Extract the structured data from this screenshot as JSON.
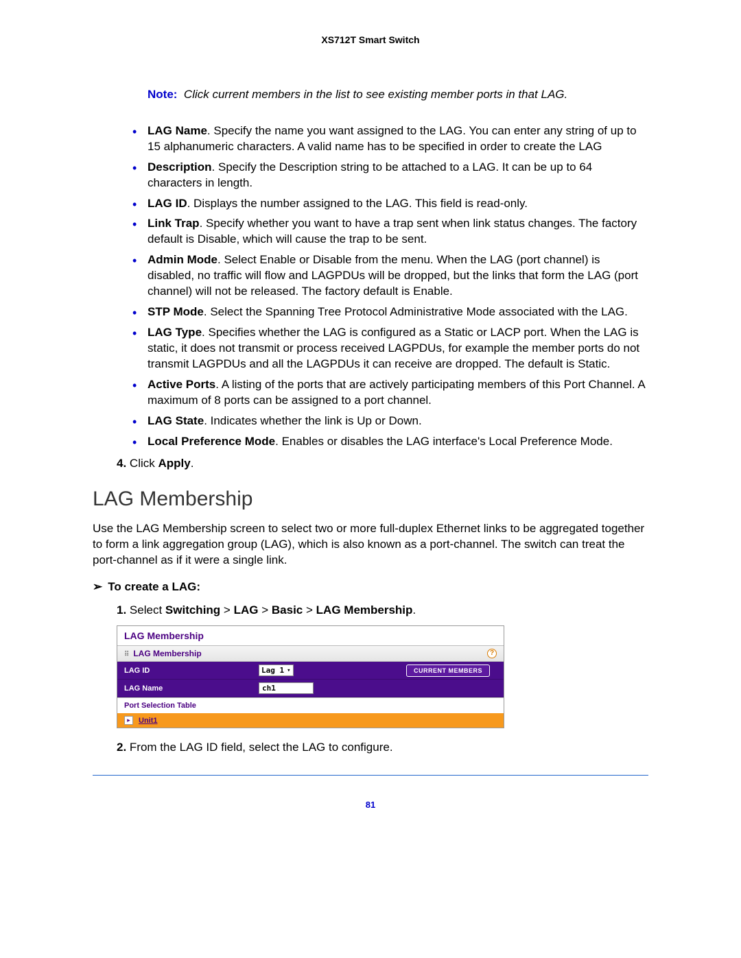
{
  "header": "XS712T Smart Switch",
  "note": {
    "label": "Note:",
    "text": "Click current members in the list to see existing member ports in that LAG."
  },
  "bullets": [
    {
      "term": "LAG Name",
      "desc": ". Specify the name you want assigned to the LAG. You can enter any string of up to 15 alphanumeric characters. A valid name has to be specified in order to create the LAG"
    },
    {
      "term": "Description",
      "desc": ". Specify the Description string to be attached to a LAG. It can be up to 64 characters in length."
    },
    {
      "term": "LAG ID",
      "desc": ". Displays the number assigned to the LAG. This field is read-only."
    },
    {
      "term": "Link Trap",
      "desc": ". Specify whether you want to have a trap sent when link status changes. The factory default is Disable, which will cause the trap to be sent."
    },
    {
      "term": "Admin Mode",
      "desc": ". Select Enable or Disable from the menu. When the LAG (port channel) is disabled, no traffic will flow and LAGPDUs will be dropped, but the links that form the LAG (port channel) will not be released. The factory default is Enable."
    },
    {
      "term": "STP Mode",
      "desc": ". Select the Spanning Tree Protocol Administrative Mode associated with the LAG."
    },
    {
      "term": "LAG Type",
      "desc": ". Specifies whether the LAG is configured as a Static or LACP port. When the LAG is static, it does not transmit or process received LAGPDUs, for example the member ports do not transmit LAGPDUs and all the LAGPDUs it can receive are dropped. The default is Static."
    },
    {
      "term": "Active Ports",
      "desc": ". A listing of the ports that are actively participating members of this Port Channel. A maximum of 8 ports can be assigned to a port channel."
    },
    {
      "term": "LAG State",
      "desc": ". Indicates whether the link is Up or Down."
    },
    {
      "term": "Local Preference Mode",
      "desc": ". Enables or disables the LAG interface's Local Preference Mode."
    }
  ],
  "step4": {
    "num": "4.",
    "pre": "Click ",
    "action": "Apply",
    "post": "."
  },
  "section_heading": "LAG Membership",
  "section_intro": "Use the LAG Membership screen to select two or more full-duplex Ethernet links to be aggregated together to form a link aggregation group (LAG), which is also known as a port-channel. The switch can treat the port-channel as if it were a single link.",
  "procedure": "To create a LAG:",
  "step1": {
    "num": "1.",
    "pre": "Select ",
    "crumbs": [
      "Switching",
      "LAG",
      "Basic",
      "LAG Membership"
    ],
    "post": "."
  },
  "screenshot": {
    "title": "LAG Membership",
    "section": "LAG Membership",
    "lag_id_label": "LAG ID",
    "lag_id_value": "Lag 1",
    "members_btn": "CURRENT MEMBERS",
    "lag_name_label": "LAG Name",
    "lag_name_value": "ch1",
    "port_table": "Port Selection Table",
    "unit": "Unit1"
  },
  "step2": {
    "num": "2.",
    "text": "From the LAG ID field, select the LAG to configure."
  },
  "page_number": "81"
}
